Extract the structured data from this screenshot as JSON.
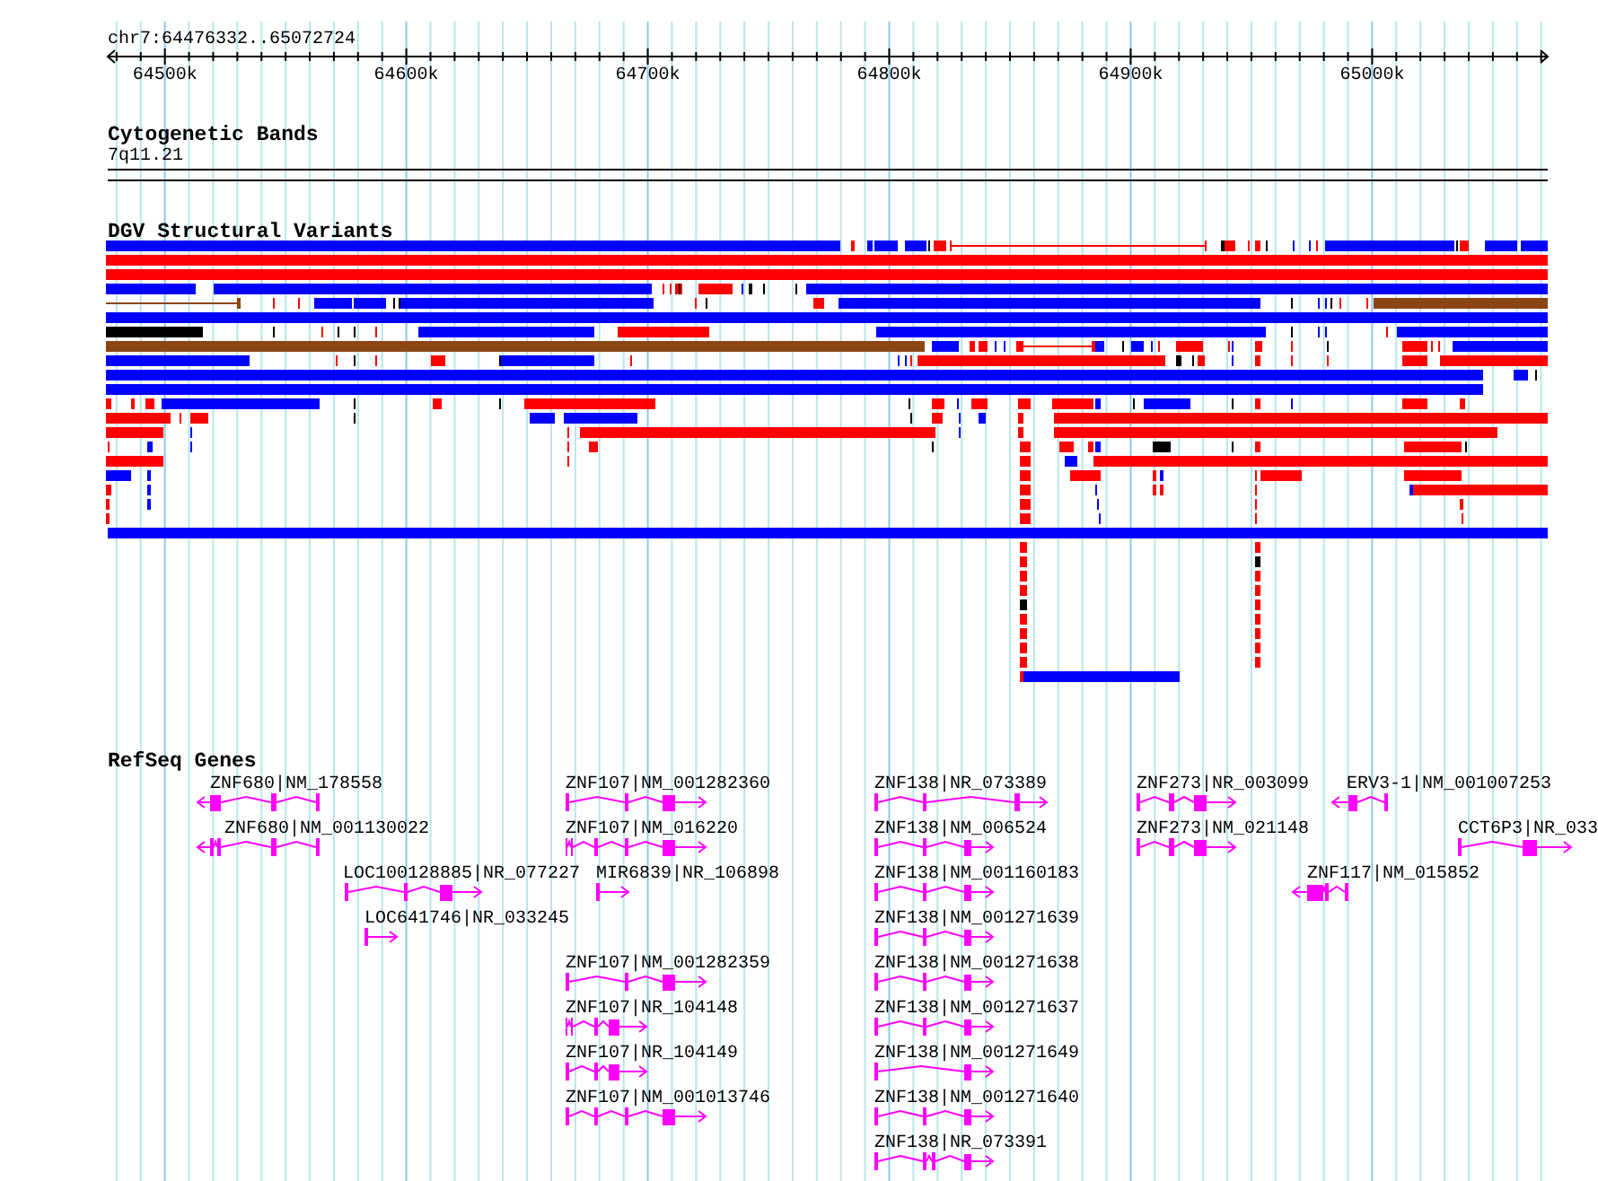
{
  "ruler": {
    "location": "chr7:64476332..65072724",
    "ticks": [
      "64500k",
      "64600k",
      "64700k",
      "64800k",
      "64900k",
      "65000k"
    ]
  },
  "tracks": [
    {
      "kind": "bands",
      "title": "Cytogenetic Bands",
      "band": "7q11.21"
    },
    {
      "kind": "variants",
      "title": "DGV Structural Variants"
    },
    {
      "kind": "genes",
      "title": "RefSeq Genes",
      "genes": [
        {
          "label": "ZNF680|NM_178558",
          "kind": "reverse"
        },
        {
          "label": "ZNF680|NM_001130022",
          "kind": "reverse"
        },
        {
          "label": "LOC100128885|NR_077227",
          "kind": "forward"
        },
        {
          "label": "LOC641746|NR_033245",
          "kind": "forward"
        },
        {
          "label": "ZNF107|NM_001282360",
          "kind": "forward"
        },
        {
          "label": "ZNF107|NM_016220",
          "kind": "forward"
        },
        {
          "label": "MIR6839|NR_106898",
          "kind": "forward"
        },
        {
          "label": "ZNF107|NM_001282359",
          "kind": "forward"
        },
        {
          "label": "ZNF107|NR_104148",
          "kind": "forward"
        },
        {
          "label": "ZNF107|NR_104149",
          "kind": "forward"
        },
        {
          "label": "ZNF107|NM_001013746",
          "kind": "forward"
        },
        {
          "label": "ZNF138|NR_073389",
          "kind": "forward"
        },
        {
          "label": "ZNF138|NM_006524",
          "kind": "forward"
        },
        {
          "label": "ZNF138|NM_001160183",
          "kind": "forward"
        },
        {
          "label": "ZNF138|NM_001271639",
          "kind": "forward"
        },
        {
          "label": "ZNF138|NM_001271638",
          "kind": "forward"
        },
        {
          "label": "ZNF138|NM_001271637",
          "kind": "forward"
        },
        {
          "label": "ZNF138|NM_001271649",
          "kind": "forward"
        },
        {
          "label": "ZNF138|NM_001271640",
          "kind": "forward"
        },
        {
          "label": "ZNF138|NR_073391",
          "kind": "forward"
        },
        {
          "label": "ZNF273|NR_003099",
          "kind": "forward"
        },
        {
          "label": "ZNF273|NM_021148",
          "kind": "forward"
        },
        {
          "label": "ERV3-1|NM_001007253",
          "kind": "reverse"
        },
        {
          "label": "CCT6P3|NR_033",
          "kind": "forward"
        },
        {
          "label": "ZNF117|NM_015852",
          "kind": "reverse"
        }
      ]
    }
  ]
}
